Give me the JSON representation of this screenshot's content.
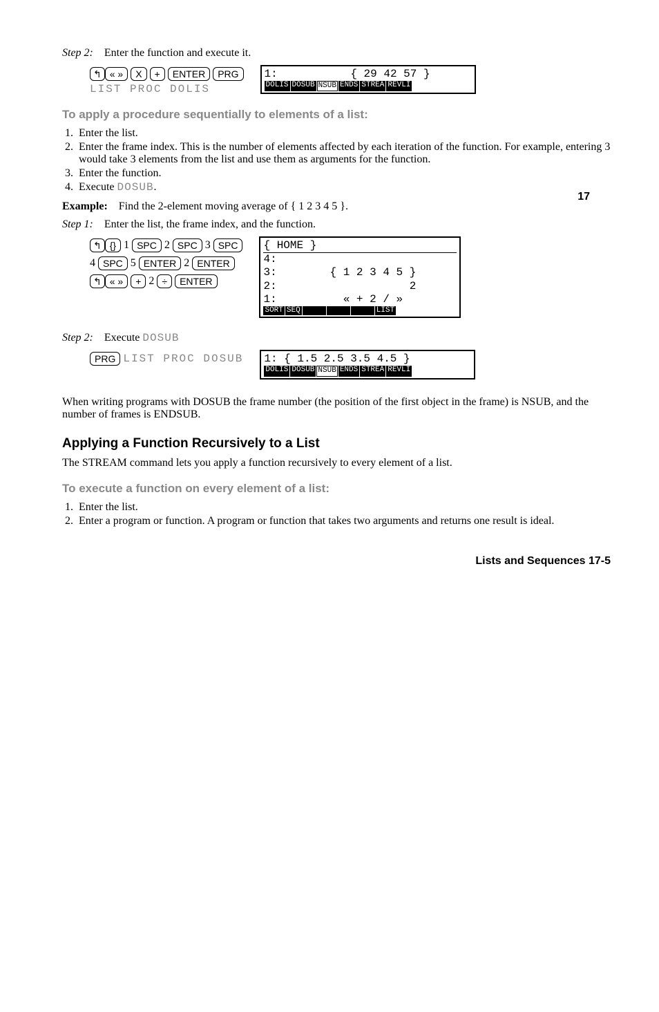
{
  "step2a": {
    "label": "Step 2:",
    "text": "Enter the function and execute it."
  },
  "keys1": {
    "shift": "↰",
    "laquo": "« »",
    "x": "X",
    "plus": "+",
    "enter": "ENTER",
    "prg": "PRG",
    "soft": "LIST  PROC  DOLIS"
  },
  "screen1": {
    "line1": "1:           { 29 42 57 }",
    "menu": [
      "DOLIS",
      "DOSUB",
      "NSUB",
      "ENDS",
      "STREA",
      "REVLI"
    ]
  },
  "heading1": "To apply a procedure sequentially to elements of a list:",
  "list1": {
    "i1": "Enter the list.",
    "i2": "Enter the frame index. This is the number of elements affected by each iteration of the function. For example, entering 3 would take 3 elements from the list and use them as arguments for the function.",
    "i3": "Enter the function.",
    "i4_a": "Execute ",
    "i4_b": "DOSUB",
    "i4_c": "."
  },
  "margin17": "17",
  "example": {
    "label": "Example:",
    "text": "Find the 2-element moving average of { 1 2 3 4 5 }."
  },
  "step1b": {
    "label": "Step 1:",
    "text": "Enter the list, the frame index, and the function."
  },
  "keys2": {
    "row1": {
      "shift": "↰",
      "brace": "{}",
      "n1": "1",
      "spc1": "SPC",
      "n2": "2",
      "spc2": "SPC",
      "n3": "3",
      "spc3": "SPC"
    },
    "row2": {
      "n4": "4",
      "spc4": "SPC",
      "n5": "5",
      "enter1": "ENTER",
      "n2b": "2",
      "enter2": "ENTER"
    },
    "row3": {
      "shift": "↰",
      "laquo": "« »",
      "plus": "+",
      "n2c": "2",
      "div": "÷",
      "enter3": "ENTER"
    }
  },
  "screen2": {
    "header": "{ HOME }",
    "l4": "4:",
    "l3": "3:        { 1 2 3 4 5 }",
    "l2": "2:                    2",
    "l1": "1:          « + 2 / »",
    "menu": [
      "SORT",
      "SEQ",
      "",
      "",
      "",
      "LIST"
    ]
  },
  "step2b": {
    "label": "Step 2:",
    "text_a": "Execute ",
    "text_b": "DOSUB"
  },
  "keys3": {
    "prg": "PRG",
    "soft": "LIST  PROC  DOSUB"
  },
  "screen3": {
    "line1": "1: { 1.5 2.5 3.5 4.5 }",
    "menu": [
      "DOLIS",
      "DOSUB",
      "NSUB",
      "ENDS",
      "STREA",
      "REVLI"
    ]
  },
  "para1": "When writing programs with DOSUB the frame number (the position of the first object in the frame) is NSUB, and the number of frames is ENDSUB.",
  "heading2": "Applying a Function Recursively to a List",
  "para2": "The STREAM command lets you apply a function recursively to every element of a list.",
  "heading3": "To execute a function on every element of a list:",
  "list2": {
    "i1": "Enter the list.",
    "i2": "Enter a program or function. A program or function that takes two arguments and returns one result is ideal."
  },
  "footer": "Lists and Sequences   17-5"
}
